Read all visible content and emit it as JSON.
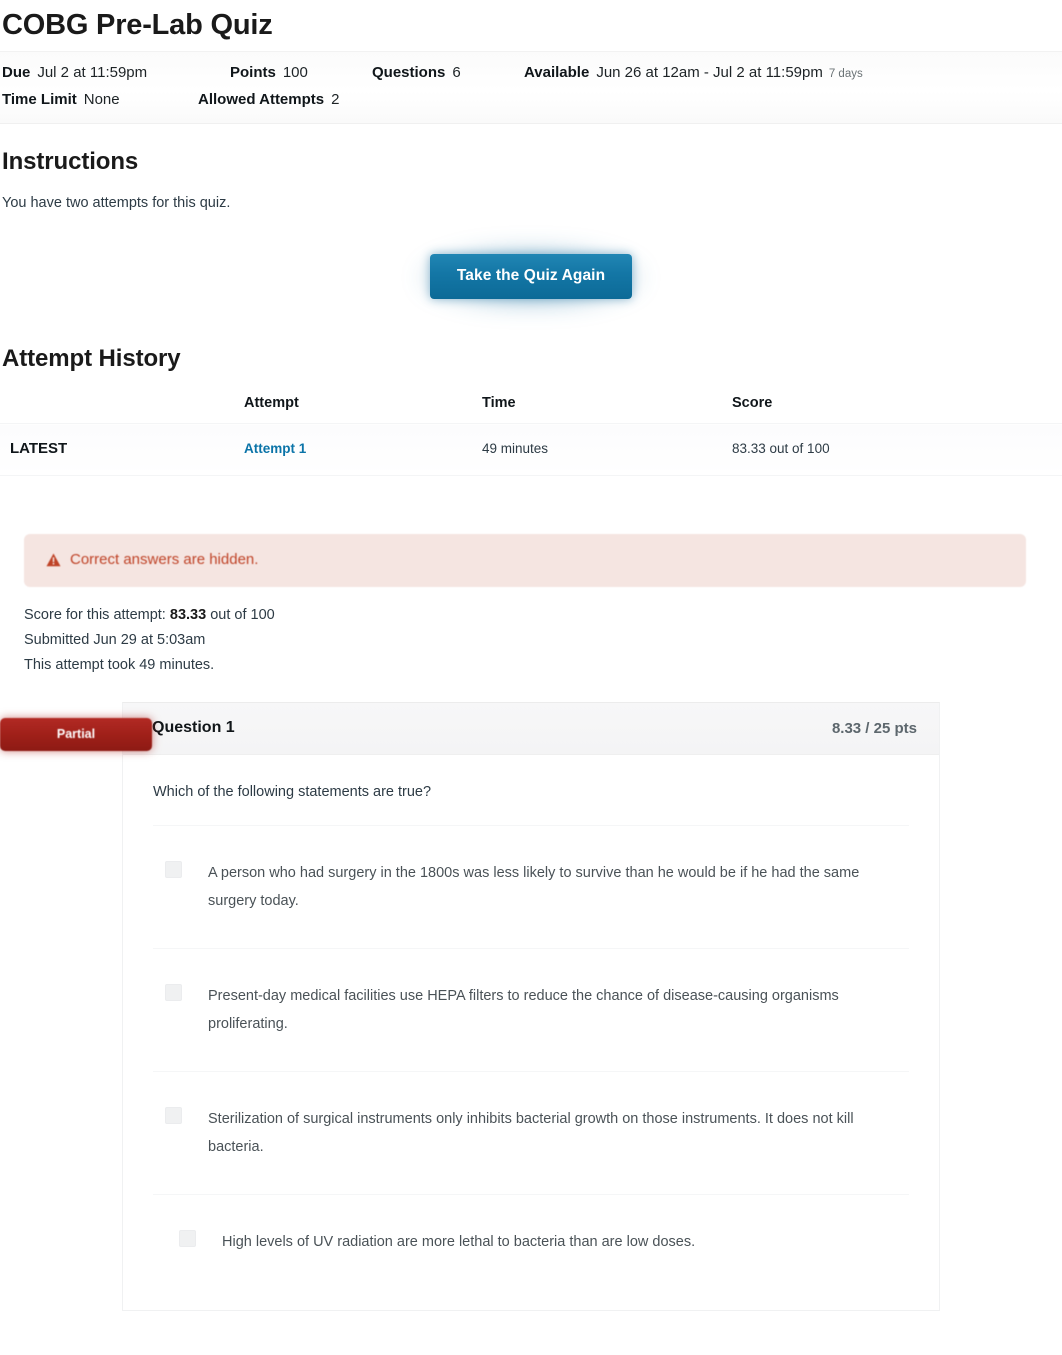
{
  "quiz": {
    "title": "COBG Pre-Lab Quiz",
    "meta": {
      "due_label": "Due",
      "due_value": "Jul 2 at 11:59pm",
      "points_label": "Points",
      "points_value": "100",
      "questions_label": "Questions",
      "questions_value": "6",
      "available_label": "Available",
      "available_value": "Jun 26 at 12am - Jul 2 at 11:59pm",
      "available_sub": "7 days",
      "time_limit_label": "Time Limit",
      "time_limit_value": "None",
      "allowed_attempts_label": "Allowed Attempts",
      "allowed_attempts_value": "2"
    }
  },
  "instructions": {
    "heading": "Instructions",
    "body": "You have two attempts for this quiz."
  },
  "actions": {
    "take_quiz_again": "Take the Quiz Again"
  },
  "attempt_history": {
    "heading": "Attempt History",
    "columns": [
      "",
      "Attempt",
      "Time",
      "Score"
    ],
    "rows": [
      {
        "flag": "LATEST",
        "attempt": "Attempt 1",
        "time": "49 minutes",
        "score": "83.33 out of 100"
      }
    ]
  },
  "notice": {
    "icon": "warning-triangle-icon",
    "text": "Correct answers are hidden.",
    "text_color": "#bf4226",
    "background_color": "#f5e5e1"
  },
  "attempt_summary": {
    "score_prefix": "Score for this attempt:",
    "score_value": "83.33",
    "score_suffix": "out of 100",
    "submitted": "Submitted Jun 29 at 5:03am",
    "duration": "This attempt took 49 minutes."
  },
  "question": {
    "status_badge": "Partial",
    "status_badge_color": "#a02019",
    "name": "Question 1",
    "points": "8.33 / 25 pts",
    "prompt": "Which of the following statements are true?",
    "answers": [
      {
        "text": "A person who had surgery in the 1800s was less likely to survive than he would be if he had the same surgery today.",
        "selected": false
      },
      {
        "text": "Present-day medical facilities use HEPA filters to reduce the chance of disease-causing organisms proliferating.",
        "selected": false
      },
      {
        "text": "Sterilization of surgical instruments only inhibits bacterial growth on those instruments. It does not kill bacteria.",
        "selected": false
      },
      {
        "text": "High levels of UV radiation are more lethal to bacteria than are low doses.",
        "selected": true
      }
    ]
  }
}
